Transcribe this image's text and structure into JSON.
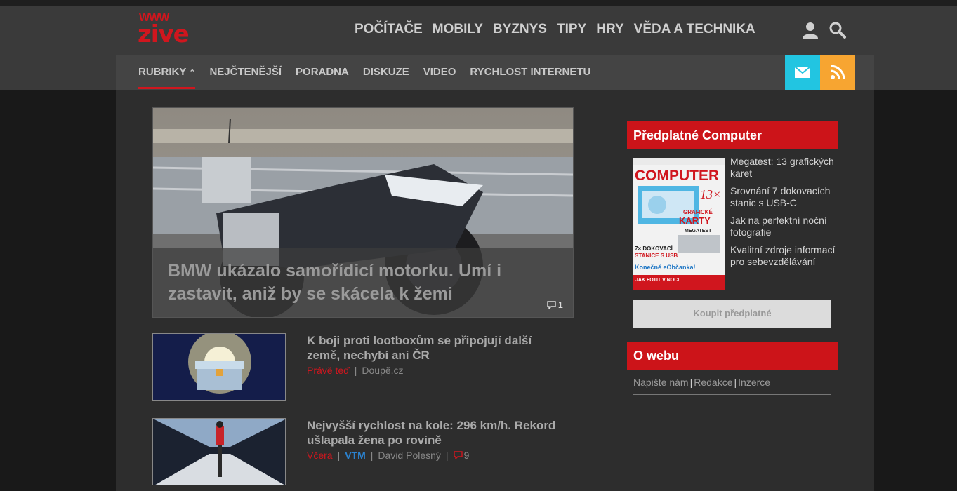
{
  "brand": {
    "logo_top": "WWW",
    "logo_text": "zive"
  },
  "mainnav": [
    "POČÍTAČE",
    "MOBILY",
    "BYZNYS",
    "TIPY",
    "HRY",
    "VĚDA A TECHNIKA"
  ],
  "subnav": {
    "active": "RUBRIKY",
    "items": [
      "NEJČTENĚJŠÍ",
      "PORADNA",
      "DISKUZE",
      "VIDEO",
      "RYCHLOST INTERNETU"
    ]
  },
  "hero": {
    "title": "BMW ukázalo samořídicí motorku. Umí i zastavit, aniž by se skácela k žemi",
    "comments": "1"
  },
  "articles": [
    {
      "title": "K boji proti lootboxům se připojují další země, nechybí ani ČR",
      "time": "Právě teď",
      "source": "Doupě.cz"
    },
    {
      "title": "Nejvyšší rychlost na kole: 296 km/h. Rekord ušlapala žena po rovině",
      "time": "Včera",
      "tag": "VTM",
      "author": "David Polesný",
      "comments": "9"
    }
  ],
  "subscription": {
    "heading": "Předplatné Computer",
    "items": [
      "Megatest: 13 grafických karet",
      "Srovnání 7 dokovacích stanic s USB-C",
      "Jak na perfektní noční fotografie",
      "Kvalitní zdroje informací pro sebevzdělávání"
    ],
    "buy_label": "Koupit předplatné",
    "cover": {
      "masthead": "COMPUTER",
      "big": "13×",
      "line1": "GRAFICKÉ",
      "line2": "KARTY",
      "line3": "MEGATEST",
      "line4": "7× DOKOVACÍ",
      "line5": "STANICE S USB",
      "line6": "Konečně eObčanka!",
      "line7": "JAK FOTIT V NOCI"
    }
  },
  "about": {
    "heading": "O webu",
    "links": [
      "Napište nám",
      "Redakce",
      "Inzerce"
    ]
  },
  "colors": {
    "accent_red": "#cc1419",
    "mail": "#22c5e1",
    "rss": "#f7a531",
    "link_blue": "#2b82cf"
  }
}
